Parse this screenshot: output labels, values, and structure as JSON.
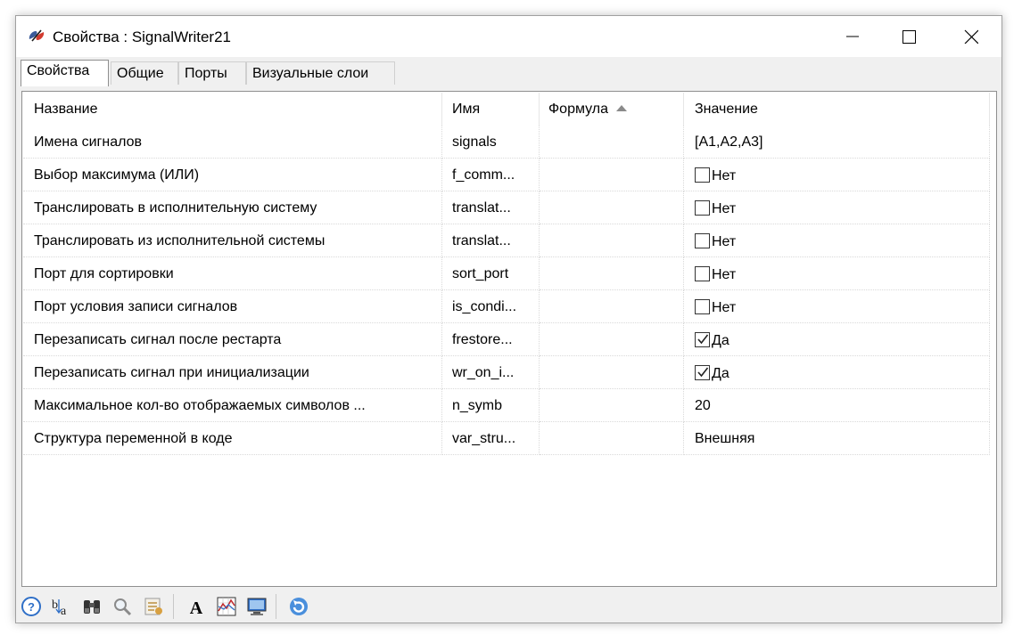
{
  "window": {
    "title": "Свойства : SignalWriter21"
  },
  "tabs": [
    {
      "label": "Свойства",
      "active": true
    },
    {
      "label": "Общие",
      "active": false
    },
    {
      "label": "Порты",
      "active": false
    },
    {
      "label": "Визуальные слои",
      "active": false
    }
  ],
  "table": {
    "columns": [
      "Название",
      "Имя",
      "Формула",
      "Значение"
    ],
    "sorted_column": "Формула",
    "rows": [
      {
        "name": "Имена сигналов",
        "id": "signals",
        "formula": "",
        "value": "[A1,A2,A3]"
      },
      {
        "name": "Выбор максимума (ИЛИ)",
        "id": "f_comm...",
        "formula": "",
        "value": "Нет",
        "checkbox": true,
        "checked": false
      },
      {
        "name": "Транслировать в исполнительную систему",
        "id": "translat...",
        "formula": "",
        "value": "Нет",
        "checkbox": true,
        "checked": false
      },
      {
        "name": "Транслировать из исполнительной системы",
        "id": "translat...",
        "formula": "",
        "value": "Нет",
        "checkbox": true,
        "checked": false
      },
      {
        "name": "Порт для сортировки",
        "id": "sort_port",
        "formula": "",
        "value": "Нет",
        "checkbox": true,
        "checked": false
      },
      {
        "name": "Порт условия записи сигналов",
        "id": "is_condi...",
        "formula": "",
        "value": "Нет",
        "checkbox": true,
        "checked": false
      },
      {
        "name": "Перезаписать сигнал после рестарта",
        "id": "frestore...",
        "formula": "",
        "value": "Да",
        "checkbox": true,
        "checked": true
      },
      {
        "name": "Перезаписать сигнал при инициализации",
        "id": "wr_on_i...",
        "formula": "",
        "value": "Да",
        "checkbox": true,
        "checked": true
      },
      {
        "name": "Максимальное кол-во отображаемых символов ...",
        "id": "n_symb",
        "formula": "",
        "value": "20"
      },
      {
        "name": "Структура переменной в коде",
        "id": "var_stru...",
        "formula": "",
        "value": "Внешняя"
      }
    ]
  },
  "toolbar": {
    "icons": [
      "help-icon",
      "sort-alpha-icon",
      "binoculars-icon",
      "magnifier-icon",
      "properties-icon",
      "font-icon",
      "chart-icon",
      "monitor-icon",
      "refresh-icon"
    ]
  }
}
